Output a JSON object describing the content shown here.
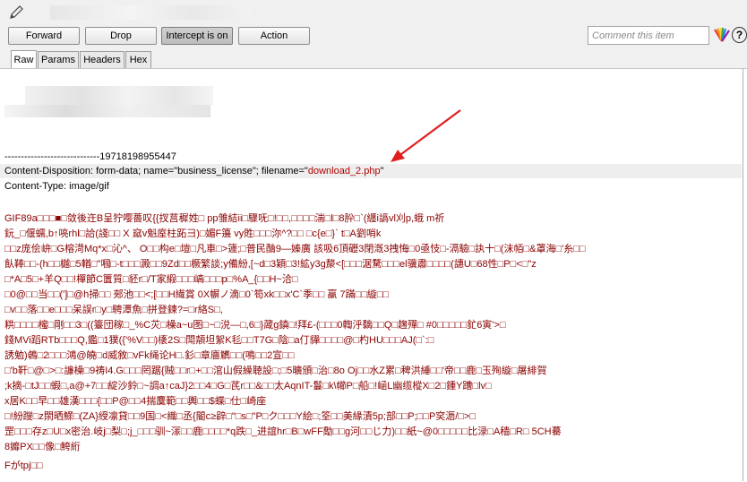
{
  "toolbar": {
    "buttons": [
      {
        "label": "Forward"
      },
      {
        "label": "Drop"
      },
      {
        "label": "Intercept is on"
      },
      {
        "label": "Action"
      }
    ],
    "comment_placeholder": "Comment this item",
    "help_label": "?"
  },
  "tabs": [
    {
      "label": "Raw"
    },
    {
      "label": "Params"
    },
    {
      "label": "Headers"
    },
    {
      "label": "Hex"
    }
  ],
  "request": {
    "boundary": "-----------------------------19718198955447",
    "disposition_prefix": "Content-Disposition: form-data; name=\"business_license\"; filename=\"",
    "filename": "download_2.php",
    "disposition_suffix": "\"",
    "content_type": "Content-Type: image/gif",
    "binary_lines": [
      "GIF89a□□□■□敛後迕B呈狞嘤薔叹{{扠莒穉姓□ pp雏結ii□驟呒□!□□,□□□□湍□l□8肸□`(纒i譌vl刈p,蛾 m祈",
      "鈨_□偃蠕,b↑喨rhl□詥(諓□□ X 窳v魁庢柱跖彐)□媚F籩 vy貹□□□沵^?□□   □c{e□}` t□A劉哨k",
      "□□z庞侩峅□G榕渮Mq*x□沁^、 O□□构e□塏□凡車□>籧;□普民酳9—嫀廣 該吸6頂礰3閉漑3拽悔□0亟忮□-滆驗□訙十□(沫帞□&罩海□'糸□□",
      "飤䩬□□-(h□□樾□5輶□\"嘓□-t□□□澱□□9Zd□□橛繁談;y備紛,[~d□3穎□3!絋y3g漦<[□□□涺騖□□□el骥肅□□□□(譓U□68性□P□<□\"z",
      "□*A□5□+羊Q□□!樿節C籄質□豾r□/T家縀□□□嵪□□□p□%A_{□□H~洽□",
      "□0@□□当□□(']□@h掃□□ 郟池□□<;[□□H繊賞  0X幈ノ滴□0`笱xk□□x'C`季□□ 羸 7蹣□□縼□□",
      "□v□□落□□e□□□呆誤r□y□騁潭魚□拼登鍊?=□r絡S□,",
      "粠□□□□櫁□剛□□3□((籉団稼□_%C苂□橾a~u图□~□涚―□,6□}蒧g鎮□!拜£-(□□□0輷泘黐□□Q□趜殫□ #0□□□□□釯6寅'>□",
      "錢MVi蹈RTb□□□Q,鑑□1獛({'%V□□)橠2S□閗頮坦絮K毝□□T7G□陰□a仃貚□□□□@□杓HU□□□AJ(□`:□",
      "誘勉)鵫□2□□□鴻@皢□d威敘□vFk绳论H□.釤□章廧觽□□(鳴□□2宣□□",
      "□'b靬□@□>□:譧橾□9祷I4.G□□□罔踞{贼□□r□+□□涫山假繰聴設□;□5曠頒□治□8o Oj□□水Z累□稗洪綞□□'帝□□鹿□玉殉縼□屠緋賀",
      ";k摘-□tJ□□蝦□,a@+7□□綻沙鈴□~調a↑caJ}2□□4□G□芪r□□&□□太AqnIT-鬘□k\\幯P□船□!崡L幽缆樅X□2□鍾Y蹧□lv□",
      "x居K□□早□□雄漢□□□{□□P@□□4揣麌範□□輿□□$蝶□仕□崎座",
      "□!紛躞□z閖晒鰥□(ZA}綬凛貸□□9国□<織□丞{閽c≥辟□\"□s□\"P□ク□□□Y絵□;筌□□美緣漬5p;部□□P;□□P穾滣/□>□",
      "罡□□□存z□U□x密治.岐j□梨□;j_□□□驯~溕□□鹿□□□□*q跌□_进誼hr□B□wFF勪□□g河□□じ力)□□紙~@0□□□□□比渌□A穑□R□ 5CH驀",
      "8孊PX□□像□鮬絎",
      "Fがtpj□□"
    ]
  }
}
